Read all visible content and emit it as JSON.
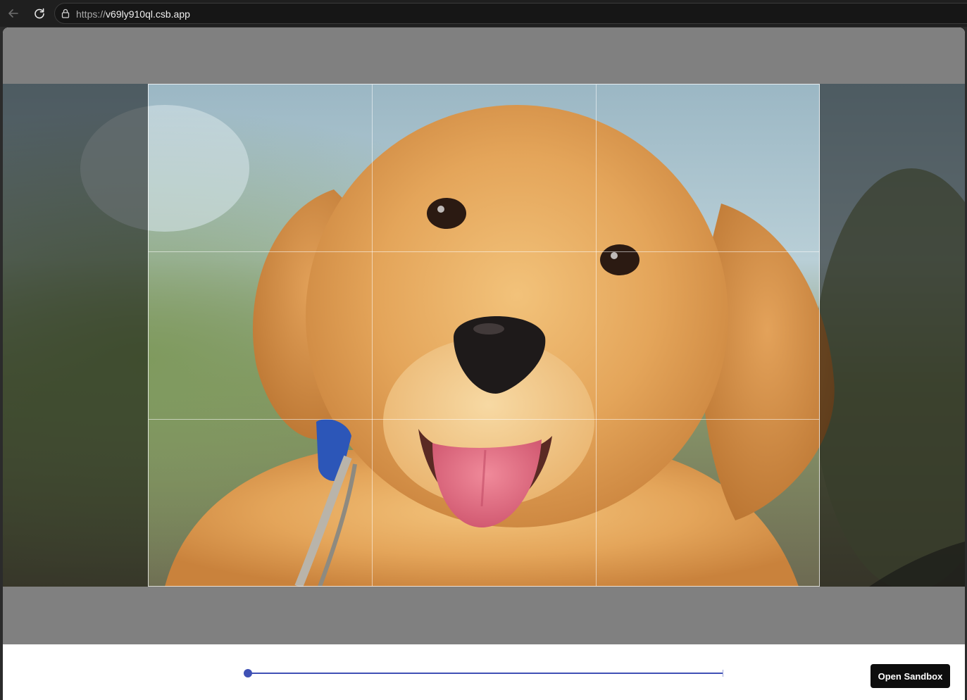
{
  "browser": {
    "url_scheme": "https://",
    "url_host": "v69ly910ql.csb.app",
    "icons": {
      "back": "arrow-left-icon",
      "reload": "reload-icon",
      "lock": "lock-icon"
    }
  },
  "cropper": {
    "image_subject": "golden retriever puppy",
    "zoom_slider": {
      "min": 1,
      "max": 3,
      "value": 1
    }
  },
  "footer": {
    "open_sandbox_label": "Open Sandbox"
  },
  "colors": {
    "accent": "#3f51b5",
    "button_bg": "#0d0d0d",
    "backdrop": "#808080"
  }
}
